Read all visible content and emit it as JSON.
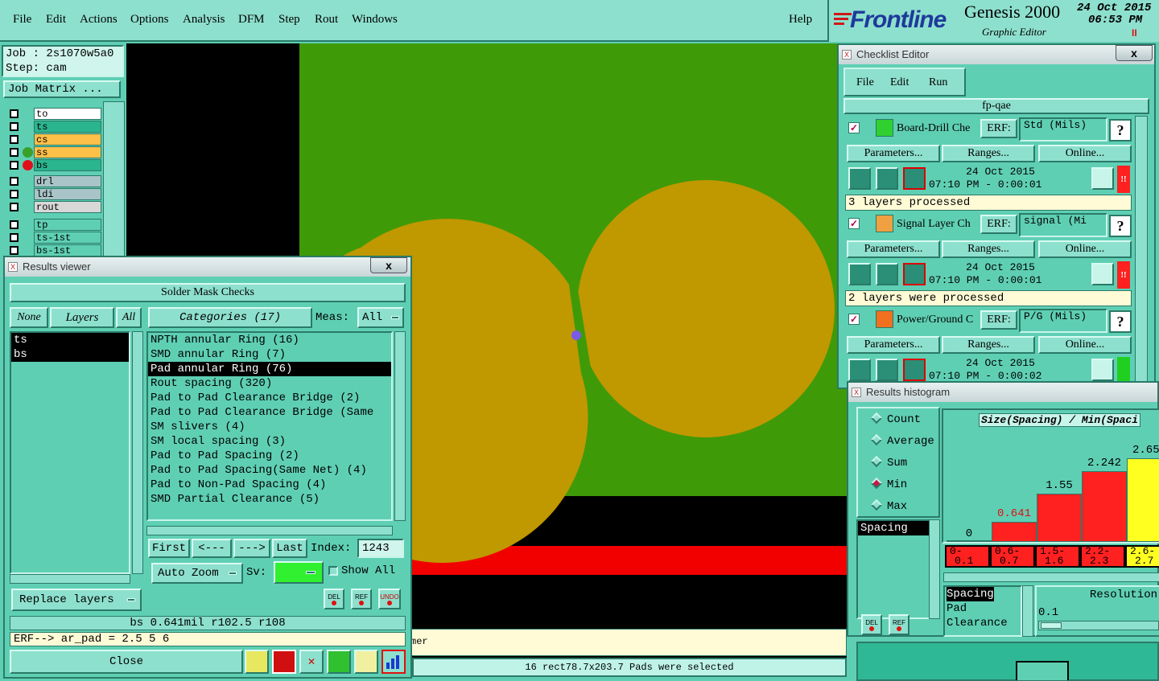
{
  "menubar": {
    "items": [
      "File",
      "Edit",
      "Actions",
      "Options",
      "Analysis",
      "DFM",
      "Step",
      "Rout",
      "Windows"
    ],
    "help": "Help"
  },
  "brand": {
    "logo": "Frontline",
    "product": "Genesis 2000",
    "subtitle": "Graphic Editor",
    "date": "24 Oct 2015",
    "time": "06:53 PM",
    "pause": "II"
  },
  "leftpanel": {
    "job": "Job : 2s1070w5a0",
    "step": "Step: cam",
    "job_matrix": "Job Matrix ...",
    "layers": [
      {
        "name": "to",
        "bg": "#ffffff",
        "dot": ""
      },
      {
        "name": "ts",
        "bg": "#2bb58f",
        "dot": ""
      },
      {
        "name": "cs",
        "bg": "#ffc04a",
        "dot": ""
      },
      {
        "name": "ss",
        "bg": "#ffc04a",
        "dot": "#3aa02a"
      },
      {
        "name": "bs",
        "bg": "#2bb58f",
        "dot": "#e0101a"
      },
      {
        "name": "drl",
        "bg": "#a9c4c8",
        "dot": ""
      },
      {
        "name": "ldi",
        "bg": "#a9c4c8",
        "dot": ""
      },
      {
        "name": "rout",
        "bg": "#d8d8d8",
        "dot": ""
      },
      {
        "name": "tp",
        "bg": "#5fcfb4",
        "dot": ""
      },
      {
        "name": "ts-1st",
        "bg": "#5fcfb4",
        "dot": ""
      },
      {
        "name": "bs-1st",
        "bg": "#5fcfb4",
        "dot": ""
      }
    ]
  },
  "canvas": {
    "status_line": "mer",
    "selection_status": "16 rect78.7x203.7 Pads were selected"
  },
  "results_viewer": {
    "title": "Results viewer",
    "close_x": "x",
    "header": "Solder Mask Checks",
    "none_btn": "None",
    "layers_btn": "Layers",
    "all_btn": "All",
    "categories_btn": "Categories (17)",
    "meas_label": "Meas:",
    "meas_value": "All",
    "layers": [
      "ts",
      "bs"
    ],
    "categories": [
      "NPTH annular Ring (16)",
      "SMD annular Ring (7)",
      "Pad annular Ring (76)",
      "Rout spacing (320)",
      "Pad to Pad Clearance Bridge (2)",
      "Pad to Pad Clearance Bridge (Same",
      "SM slivers (4)",
      "SM local spacing (3)",
      "Pad to Pad Spacing (2)",
      "Pad to Pad Spacing(Same Net) (4)",
      "Pad to Non-Pad Spacing (4)",
      "SMD Partial Clearance (5)"
    ],
    "selected_category": 2,
    "nav": {
      "first": "First",
      "prev": "<---",
      "next": "--->",
      "last": "Last",
      "index_label": "Index:",
      "index_value": "1243"
    },
    "auto_zoom": "Auto Zoom",
    "sv_label": "Sv:",
    "show_all": "Show All",
    "replace_layers": "Replace layers",
    "del": "DEL",
    "ref": "REF",
    "undo": "UNDO",
    "info": "bs 0.641mil  r102.5  r108",
    "erf": "ERF--> ar_pad = 2.5 5 6",
    "close": "Close"
  },
  "checklist": {
    "title": "Checklist Editor",
    "close_x": "x",
    "menu": [
      "File",
      "Edit",
      "Run"
    ],
    "name": "fp-qae",
    "params_label": "Parameters...",
    "ranges_label": "Ranges...",
    "online_label": "Online...",
    "erf_label": "ERF:",
    "help": "?",
    "items": [
      {
        "name": "Board-Drill Che",
        "erf": "Std (Mils)",
        "date": "24 Oct 2015",
        "time": "07:10 PM - 0:00:01",
        "msg": "3 layers processed",
        "status": "#ff2020",
        "flag": "!!"
      },
      {
        "name": "Signal Layer Ch",
        "erf": "signal (Mi",
        "date": "24 Oct 2015",
        "time": "07:10 PM - 0:00:01",
        "msg": "2 layers were processed",
        "status": "#ff2020",
        "flag": "!!"
      },
      {
        "name": "Power/Ground C",
        "erf": "P/G (Mils)",
        "date": "24 Oct 2015",
        "time": "07:10 PM - 0:00:02",
        "msg": "",
        "status": "#20d020",
        "flag": ""
      }
    ]
  },
  "histogram": {
    "title": "Results histogram",
    "radios": [
      "Count",
      "Average",
      "Sum",
      "Min",
      "Max"
    ],
    "selected_radio": 3,
    "list_item": "Spacing",
    "chart_title": "Size(Spacing) / Min(Spaci",
    "bars": [
      {
        "value": "0",
        "range1": "0-",
        "range2": "0.1",
        "color": "#ff2020",
        "h": 0
      },
      {
        "value": "0.641",
        "range1": "0.6-",
        "range2": "0.7",
        "color": "#ff2020",
        "h": 0.24
      },
      {
        "value": "1.55",
        "range1": "1.5-",
        "range2": "1.6",
        "color": "#ff2020",
        "h": 0.58
      },
      {
        "value": "2.242",
        "range1": "2.2-",
        "range2": "2.3",
        "color": "#ff2020",
        "h": 0.845
      },
      {
        "value": "2.655",
        "range1": "2.6-",
        "range2": "2.7",
        "color": "#ffff20",
        "h": 1
      }
    ],
    "info_lines": [
      "Spacing",
      "Pad",
      "Clearance"
    ],
    "resolution_label": "Resolution",
    "resolution_value": "0.1",
    "del": "DEL",
    "ref": "REF"
  }
}
